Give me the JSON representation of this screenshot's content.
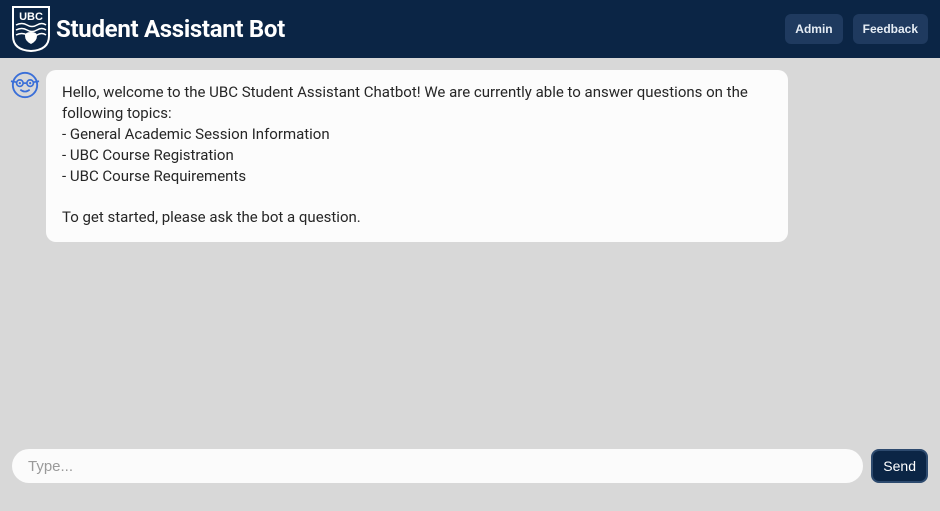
{
  "header": {
    "title": "Student Assistant Bot",
    "logo_text": "UBC",
    "admin_label": "Admin",
    "feedback_label": "Feedback"
  },
  "message": {
    "intro": "Hello, welcome to the UBC Student Assistant Chatbot! We are currently able to answer questions on the following topics:",
    "topic1": "- General Academic Session Information",
    "topic2": "- UBC Course Registration",
    "topic3": "- UBC Course Requirements",
    "outro": "To get started, please ask the bot a question."
  },
  "composer": {
    "placeholder": "Type...",
    "send_label": "Send"
  }
}
